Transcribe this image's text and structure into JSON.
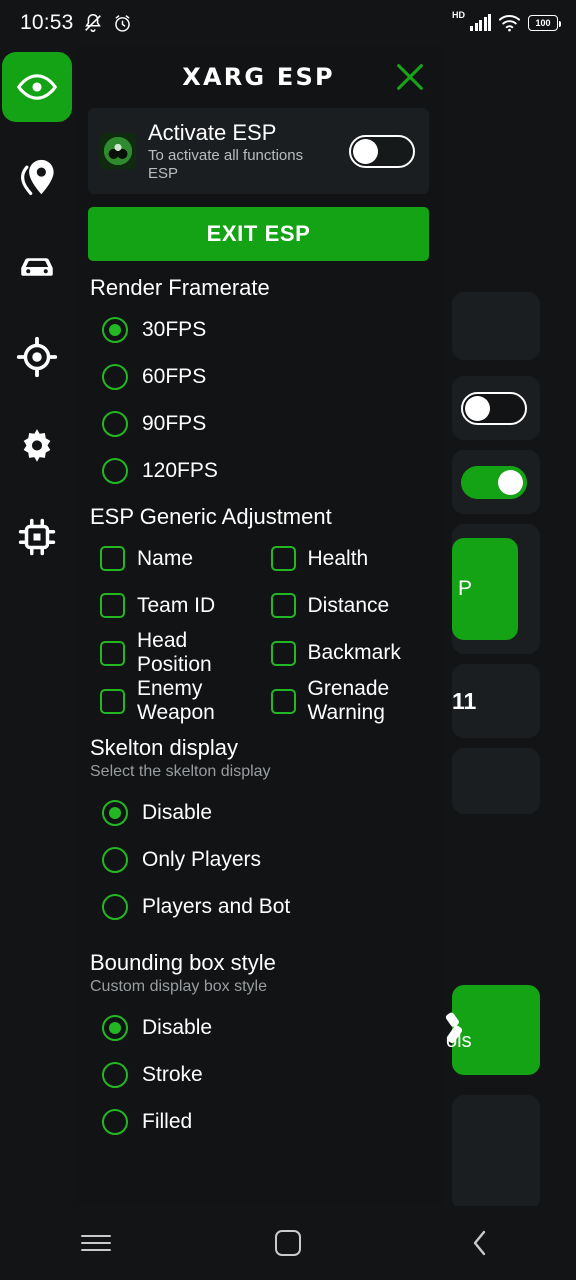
{
  "status_bar": {
    "time": "10:53",
    "icons": [
      "mute-bell-icon",
      "alarm-clock-icon"
    ],
    "network_label": "HD",
    "battery_level": "100",
    "wifi_generation": "6"
  },
  "sidebar": {
    "items": [
      {
        "name": "eye-icon",
        "label": "ESP",
        "active": true
      },
      {
        "name": "location-pin-icon",
        "label": "Location",
        "active": false
      },
      {
        "name": "car-icon",
        "label": "Vehicle",
        "active": false
      },
      {
        "name": "target-crosshair-icon",
        "label": "Aim",
        "active": false
      },
      {
        "name": "gear-icon",
        "label": "Settings",
        "active": false
      },
      {
        "name": "chip-icon",
        "label": "Memory",
        "active": false
      }
    ]
  },
  "panel": {
    "title": "XARG ESP",
    "close_label": "close-icon",
    "activate_card": {
      "title": "Activate ESP",
      "subtitle": "To activate all functions ESP",
      "toggle_state": "off"
    },
    "exit_button": "EXIT ESP",
    "sections": [
      {
        "id": "render-framerate",
        "title": "Render Framerate",
        "subtitle": "",
        "type": "radio",
        "options": [
          {
            "label": "30FPS",
            "selected": true
          },
          {
            "label": "60FPS",
            "selected": false
          },
          {
            "label": "90FPS",
            "selected": false
          },
          {
            "label": "120FPS",
            "selected": false
          }
        ]
      },
      {
        "id": "esp-generic-adjustment",
        "title": "ESP Generic Adjustment",
        "subtitle": "",
        "type": "checkbox-grid",
        "options": [
          {
            "label": "Name",
            "checked": false
          },
          {
            "label": "Health",
            "checked": false
          },
          {
            "label": "Team ID",
            "checked": false
          },
          {
            "label": "Distance",
            "checked": false
          },
          {
            "label": "Head Position",
            "checked": false
          },
          {
            "label": "Backmark",
            "checked": false
          },
          {
            "label": "Enemy Weapon",
            "checked": false
          },
          {
            "label": "Grenade Warning",
            "checked": false
          }
        ]
      },
      {
        "id": "skelton-display",
        "title": "Skelton display",
        "subtitle": "Select the skelton display",
        "type": "radio",
        "options": [
          {
            "label": "Disable",
            "selected": true
          },
          {
            "label": "Only Players",
            "selected": false
          },
          {
            "label": "Players and Bot",
            "selected": false
          }
        ]
      },
      {
        "id": "bounding-box-style",
        "title": "Bounding box style",
        "subtitle": "Custom display box style",
        "type": "radio",
        "options": [
          {
            "label": "Disable",
            "selected": true
          },
          {
            "label": "Stroke",
            "selected": false
          },
          {
            "label": "Filled",
            "selected": false
          }
        ]
      }
    ]
  },
  "background": {
    "green_button_text": "P",
    "counter_text": "11",
    "tool_card_label": "ols",
    "toggle_off_state": "off",
    "toggle_on_state": "on"
  },
  "navbar": {
    "recents": "recents-icon",
    "home": "home-icon",
    "back": "back-icon"
  },
  "colors": {
    "accent_green": "#14a314",
    "control_green": "#23b723",
    "panel_bg": "#111314",
    "card_bg": "#1b1e20",
    "text_primary": "#ffffff",
    "text_secondary": "#9a9da0"
  }
}
